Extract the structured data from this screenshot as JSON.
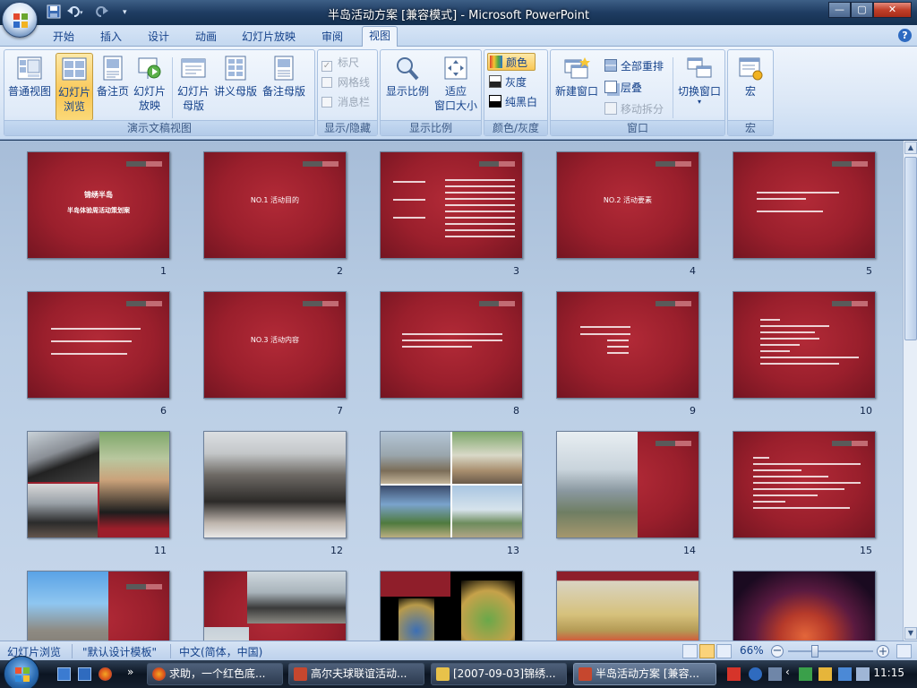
{
  "window": {
    "title": "半岛活动方案 [兼容模式] - Microsoft PowerPoint",
    "buttons": [
      "—",
      "▢",
      "✕"
    ]
  },
  "tabs": [
    {
      "label": "开始",
      "active": false
    },
    {
      "label": "插入",
      "active": false
    },
    {
      "label": "设计",
      "active": false
    },
    {
      "label": "动画",
      "active": false
    },
    {
      "label": "幻灯片放映",
      "active": false
    },
    {
      "label": "审阅",
      "active": false
    },
    {
      "label": "视图",
      "active": true
    }
  ],
  "ribbon": {
    "groups": {
      "presentation_views": {
        "label": "演示文稿视图",
        "buttons": [
          {
            "label": "普通视图"
          },
          {
            "label": "幻灯片\n浏览",
            "selected": true
          },
          {
            "label": "备注页"
          },
          {
            "label": "幻灯片\n放映"
          },
          {
            "label": "幻灯片\n母版"
          },
          {
            "label": "讲义母版"
          },
          {
            "label": "备注母版"
          }
        ]
      },
      "show_hide": {
        "label": "显示/隐藏",
        "items": [
          {
            "label": "标尺",
            "checked": true,
            "disabled": true
          },
          {
            "label": "网格线",
            "checked": false,
            "disabled": true
          },
          {
            "label": "消息栏",
            "checked": false,
            "disabled": true
          }
        ]
      },
      "zoom": {
        "label": "显示比例",
        "buttons": [
          {
            "label": "显示比例"
          },
          {
            "label": "适应\n窗口大小"
          }
        ]
      },
      "color": {
        "label": "颜色/灰度",
        "items": [
          {
            "label": "颜色",
            "selected": true
          },
          {
            "label": "灰度"
          },
          {
            "label": "纯黑白"
          }
        ]
      },
      "window": {
        "label": "窗口",
        "new_window": "新建窗口",
        "items": [
          {
            "label": "全部重排",
            "disabled": false
          },
          {
            "label": "层叠",
            "disabled": false
          },
          {
            "label": "移动拆分",
            "disabled": true
          }
        ],
        "switch": "切换窗口"
      },
      "macro": {
        "label": "宏",
        "button": "宏"
      }
    }
  },
  "slides": [
    {
      "num": "1",
      "kind": "title",
      "title": "锦绣半岛",
      "subtitle": "半岛体验周活动策划案"
    },
    {
      "num": "2",
      "kind": "section",
      "title": "NO.1 活动目的"
    },
    {
      "num": "3",
      "kind": "text"
    },
    {
      "num": "4",
      "kind": "section",
      "title": "NO.2 活动要素"
    },
    {
      "num": "5",
      "kind": "text"
    },
    {
      "num": "6",
      "kind": "text"
    },
    {
      "num": "7",
      "kind": "section",
      "title": "NO.3 活动内容"
    },
    {
      "num": "8",
      "kind": "text"
    },
    {
      "num": "9",
      "kind": "text"
    },
    {
      "num": "10",
      "kind": "text"
    },
    {
      "num": "11",
      "kind": "photo"
    },
    {
      "num": "12",
      "kind": "photo"
    },
    {
      "num": "13",
      "kind": "photo"
    },
    {
      "num": "14",
      "kind": "photo"
    },
    {
      "num": "15",
      "kind": "text"
    },
    {
      "num": "",
      "kind": "photo"
    },
    {
      "num": "",
      "kind": "photo"
    },
    {
      "num": "",
      "kind": "photo"
    },
    {
      "num": "",
      "kind": "photo"
    },
    {
      "num": "",
      "kind": "photo"
    }
  ],
  "statusbar": {
    "view": "幻灯片浏览",
    "theme": "\"默认设计模板\"",
    "language": "中文(简体，中国)",
    "zoom": "66%",
    "zoom_level_pct": 66
  },
  "taskbar": {
    "tasks": [
      {
        "label": "求助，一个红色底...",
        "active": false
      },
      {
        "label": "高尔夫球联谊活动...",
        "active": false
      },
      {
        "label": "[2007-09-03]锦绣...",
        "active": false
      },
      {
        "label": "半岛活动方案 [兼容...",
        "active": true
      }
    ],
    "clock": "11:15"
  }
}
